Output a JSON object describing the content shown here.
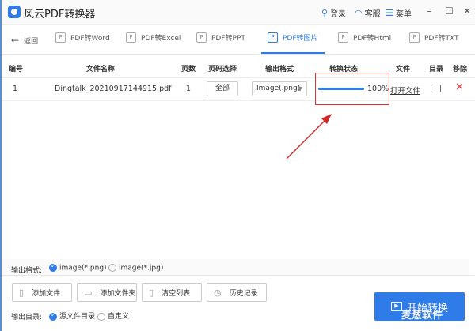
{
  "app": {
    "title": "风云PDF转换器",
    "login": "登录",
    "service": "客服",
    "menu": "菜单"
  },
  "nav": {
    "back": "返回",
    "tabs": [
      {
        "label": "PDF转Word"
      },
      {
        "label": "PDF转Excel"
      },
      {
        "label": "PDF转PPT"
      },
      {
        "label": "PDF转图片",
        "active": true
      },
      {
        "label": "PDF转Html"
      },
      {
        "label": "PDF转TXT"
      }
    ]
  },
  "table": {
    "headers": [
      "编号",
      "文件名称",
      "页数",
      "页码选择",
      "输出格式",
      "转换状态",
      "文件",
      "目录",
      "移除"
    ],
    "rows": [
      {
        "index": "1",
        "filename": "Dingtalk_20210917144915.pdf",
        "pages": "1",
        "page_select": "全部",
        "format": "Image(.png)",
        "progress": 100,
        "progress_label": "100%",
        "open_file": "打开文件"
      }
    ]
  },
  "bottom": {
    "format_label": "输出格式:",
    "format_options": [
      "image(*.png)",
      "image(*.jpg)"
    ],
    "format_selected": "image(*.png)",
    "buttons": [
      "添加文件",
      "添加文件夹",
      "清空列表",
      "历史记录"
    ],
    "dir_label": "输出目录:",
    "dir_options": [
      "源文件目录",
      "自定义"
    ],
    "dir_selected": "源文件目录",
    "start": "开始转换"
  },
  "watermark": "麦葱软件",
  "colors": {
    "accent": "#2f7be8",
    "highlight": "#e03030"
  }
}
